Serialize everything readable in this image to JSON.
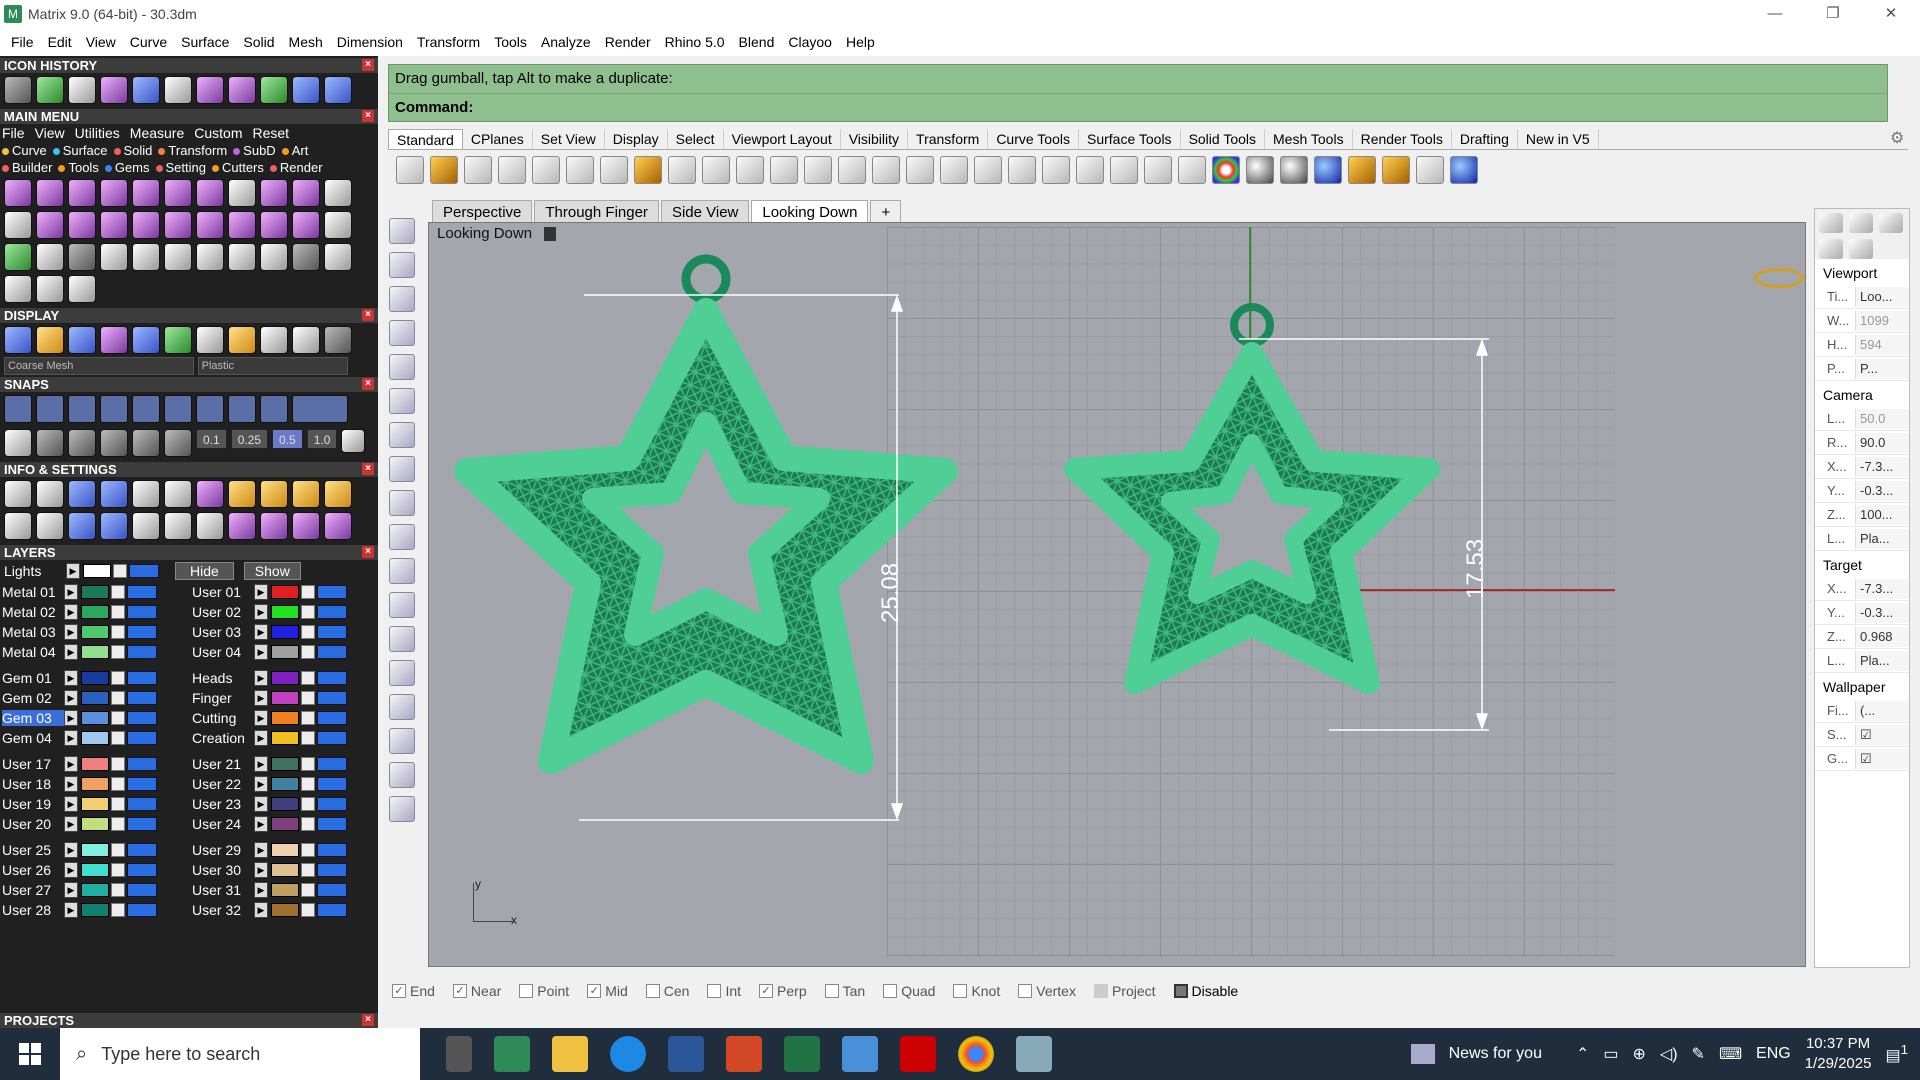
{
  "window": {
    "title": "Matrix 9.0 (64-bit) - 30.3dm",
    "controls": [
      "—",
      "❐",
      "✕"
    ]
  },
  "menubar": [
    "File",
    "Edit",
    "View",
    "Curve",
    "Surface",
    "Solid",
    "Mesh",
    "Dimension",
    "Transform",
    "Tools",
    "Analyze",
    "Render",
    "Rhino 5.0",
    "Blend",
    "Clayoo",
    "Help"
  ],
  "left_panel": {
    "icon_history": {
      "title": "ICON HISTORY"
    },
    "main_menu": {
      "title": "MAIN MENU",
      "row1": [
        "File",
        "View",
        "Utilities",
        "Measure",
        "Custom",
        "Reset"
      ],
      "row2": [
        {
          "label": "Curve",
          "color": "#f0c040"
        },
        {
          "label": "Surface",
          "color": "#40c0f0"
        },
        {
          "label": "Solid",
          "color": "#f06060"
        },
        {
          "label": "Transform",
          "color": "#f08040"
        },
        {
          "label": "SubD",
          "color": "#c060f0"
        },
        {
          "label": "Art",
          "color": "#f0a020"
        }
      ],
      "row3": [
        {
          "label": "Builder",
          "color": "#f06060"
        },
        {
          "label": "Tools",
          "color": "#f0a020"
        },
        {
          "label": "Gems",
          "color": "#4080f0"
        },
        {
          "label": "Setting",
          "color": "#f06060"
        },
        {
          "label": "Cutters",
          "color": "#f0a020"
        },
        {
          "label": "Render",
          "color": "#f06060"
        }
      ]
    },
    "display": {
      "title": "DISPLAY",
      "mesh_select": "Coarse Mesh",
      "material_select": "Plastic"
    },
    "snaps": {
      "title": "SNAPS",
      "values": [
        "0.1",
        "0.25",
        "0.5",
        "1.0"
      ]
    },
    "info_settings": {
      "title": "INFO & SETTINGS"
    },
    "layers": {
      "title": "LAYERS",
      "lights": "Lights",
      "hide": "Hide",
      "show": "Show",
      "left_col": [
        {
          "name": "Metal 01",
          "color": "#1a7a5a"
        },
        {
          "name": "Metal 02",
          "color": "#2aa860"
        },
        {
          "name": "Metal 03",
          "color": "#50c870"
        },
        {
          "name": "Metal 04",
          "color": "#90e090"
        },
        {
          "name": "",
          "color": ""
        },
        {
          "name": "Gem 01",
          "color": "#1a3aa0"
        },
        {
          "name": "Gem 02",
          "color": "#2a60c0"
        },
        {
          "name": "Gem 03",
          "color": "#5a90e0",
          "active": true
        },
        {
          "name": "Gem 04",
          "color": "#a0c8f0"
        },
        {
          "name": "",
          "color": ""
        },
        {
          "name": "User 17",
          "color": "#f08080"
        },
        {
          "name": "User 18",
          "color": "#f0a060"
        },
        {
          "name": "User 19",
          "color": "#f0d070"
        },
        {
          "name": "User 20",
          "color": "#c0e080"
        },
        {
          "name": "",
          "color": ""
        },
        {
          "name": "User 25",
          "color": "#80f0e0"
        },
        {
          "name": "User 26",
          "color": "#40e0d0"
        },
        {
          "name": "User 27",
          "color": "#20b0a0"
        },
        {
          "name": "User 28",
          "color": "#108070"
        }
      ],
      "right_col": [
        {
          "name": "User 01",
          "color": "#e02020"
        },
        {
          "name": "User 02",
          "color": "#20e020"
        },
        {
          "name": "User 03",
          "color": "#2020e0"
        },
        {
          "name": "User 04",
          "color": "#a0a0a0"
        },
        {
          "name": "",
          "color": ""
        },
        {
          "name": "Heads",
          "color": "#8020c0"
        },
        {
          "name": "Finger",
          "color": "#c040c0"
        },
        {
          "name": "Cutting",
          "color": "#f08020"
        },
        {
          "name": "Creation",
          "color": "#f0c020"
        },
        {
          "name": "",
          "color": ""
        },
        {
          "name": "User 21",
          "color": "#407060"
        },
        {
          "name": "User 22",
          "color": "#4080a0"
        },
        {
          "name": "User 23",
          "color": "#404080"
        },
        {
          "name": "User 24",
          "color": "#804080"
        },
        {
          "name": "",
          "color": ""
        },
        {
          "name": "User 29",
          "color": "#f0d0b0"
        },
        {
          "name": "User 30",
          "color": "#e0c090"
        },
        {
          "name": "User 31",
          "color": "#c0a060"
        },
        {
          "name": "User 32",
          "color": "#a07030"
        }
      ]
    },
    "projects": {
      "title": "PROJECTS"
    }
  },
  "command": {
    "prompt": "Drag gumball, tap Alt to make a duplicate:",
    "label": "Command:"
  },
  "toolbar_tabs": [
    "Standard",
    "CPlanes",
    "Set View",
    "Display",
    "Select",
    "Viewport Layout",
    "Visibility",
    "Transform",
    "Curve Tools",
    "Surface Tools",
    "Solid Tools",
    "Mesh Tools",
    "Render Tools",
    "Drafting",
    "New in V5"
  ],
  "viewport_tabs": [
    "Perspective",
    "Through Finger",
    "Side View",
    "Looking Down"
  ],
  "viewport": {
    "active_label": "Looking Down",
    "dimension_left": "25.08",
    "dimension_right": "17.53",
    "axis_y": "y",
    "axis_x": "x"
  },
  "properties": {
    "viewport_section": "Viewport",
    "viewport_rows": [
      {
        "k": "Ti...",
        "v": "Loo..."
      },
      {
        "k": "W...",
        "v": "1099",
        "dim": true
      },
      {
        "k": "H...",
        "v": "594",
        "dim": true
      },
      {
        "k": "P...",
        "v": "P..."
      }
    ],
    "camera_section": "Camera",
    "camera_rows": [
      {
        "k": "L...",
        "v": "50.0",
        "dim": true
      },
      {
        "k": "R...",
        "v": "90.0"
      },
      {
        "k": "X...",
        "v": "-7.3..."
      },
      {
        "k": "Y...",
        "v": "-0.3..."
      },
      {
        "k": "Z...",
        "v": "100..."
      },
      {
        "k": "L...",
        "v": "Pla..."
      }
    ],
    "target_section": "Target",
    "target_rows": [
      {
        "k": "X...",
        "v": "-7.3..."
      },
      {
        "k": "Y...",
        "v": "-0.3..."
      },
      {
        "k": "Z...",
        "v": "0.968"
      },
      {
        "k": "L...",
        "v": "Pla..."
      }
    ],
    "wallpaper_section": "Wallpaper",
    "wallpaper_rows": [
      {
        "k": "Fi...",
        "v": "(..."
      },
      {
        "k": "S...",
        "v": "☑"
      },
      {
        "k": "G...",
        "v": "☑"
      }
    ]
  },
  "osnaps": [
    {
      "label": "End",
      "checked": true,
      "disabled": true
    },
    {
      "label": "Near",
      "checked": true,
      "disabled": true
    },
    {
      "label": "Point",
      "checked": false,
      "disabled": true
    },
    {
      "label": "Mid",
      "checked": true,
      "disabled": true
    },
    {
      "label": "Cen",
      "checked": false,
      "disabled": true
    },
    {
      "label": "Int",
      "checked": false,
      "disabled": true
    },
    {
      "label": "Perp",
      "checked": true,
      "disabled": true
    },
    {
      "label": "Tan",
      "checked": false,
      "disabled": true
    },
    {
      "label": "Quad",
      "checked": false,
      "disabled": true
    },
    {
      "label": "Knot",
      "checked": false,
      "disabled": true
    },
    {
      "label": "Vertex",
      "checked": false,
      "disabled": true
    },
    {
      "label": "Project",
      "checked": false,
      "disabled": true
    },
    {
      "label": "Disable",
      "checked": false,
      "disabled": false
    }
  ],
  "taskbar": {
    "search_placeholder": "Type here to search",
    "news": "News for you",
    "lang": "ENG",
    "time": "10:37 PM",
    "date": "1/29/2025",
    "notifications": "1"
  }
}
